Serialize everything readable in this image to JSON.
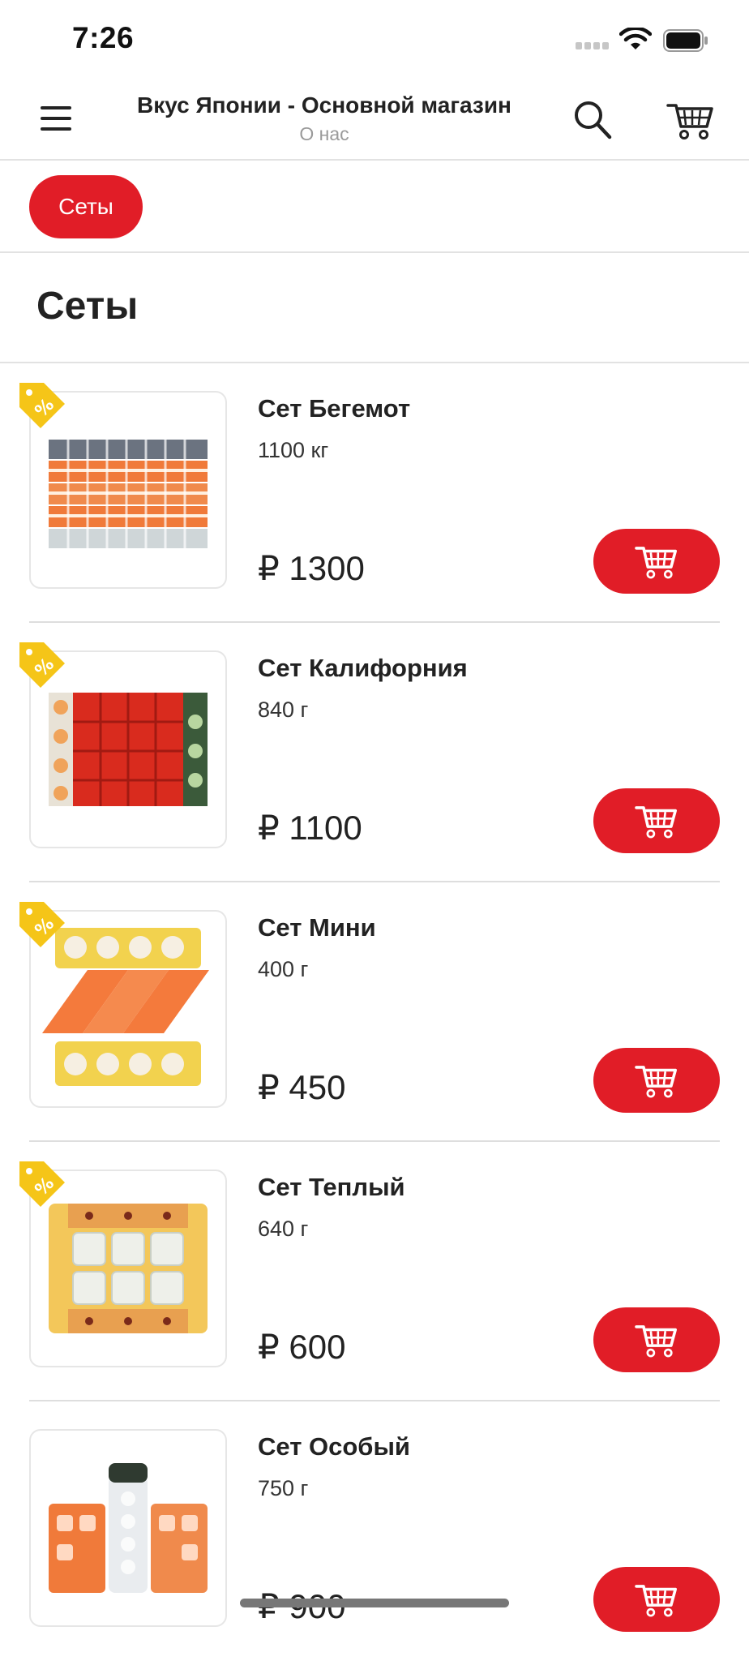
{
  "status_bar": {
    "time": "7:26"
  },
  "header": {
    "title": "Вкус Японии - Основной магазин",
    "subtitle": "О нас",
    "icons": {
      "menu": "hamburger-menu-icon",
      "search": "search-icon",
      "cart": "cart-icon"
    }
  },
  "categories": [
    {
      "label": "Сеты",
      "active": true
    }
  ],
  "section": {
    "title": "Сеты"
  },
  "products": [
    {
      "name": "Сет Бегемот",
      "weight": "1100 кг",
      "price": "₽ 1300",
      "discount_tag": true,
      "image": "sushi-set-behemoth"
    },
    {
      "name": "Сет Калифорния",
      "weight": "840 г",
      "price": "₽ 1100",
      "discount_tag": true,
      "image": "sushi-set-california"
    },
    {
      "name": "Сет Мини",
      "weight": "400 г",
      "price": "₽ 450",
      "discount_tag": true,
      "image": "sushi-set-mini"
    },
    {
      "name": "Сет Теплый",
      "weight": "640 г",
      "price": "₽ 600",
      "discount_tag": true,
      "image": "sushi-set-warm"
    },
    {
      "name": "Сет Особый",
      "weight": "750 г",
      "price": "₽ 900",
      "discount_tag": false,
      "image": "sushi-set-special"
    }
  ],
  "colors": {
    "accent": "#e11d27",
    "tag": "#f5c518",
    "divider": "#e2e2e2",
    "muted": "#9a9a9a"
  }
}
